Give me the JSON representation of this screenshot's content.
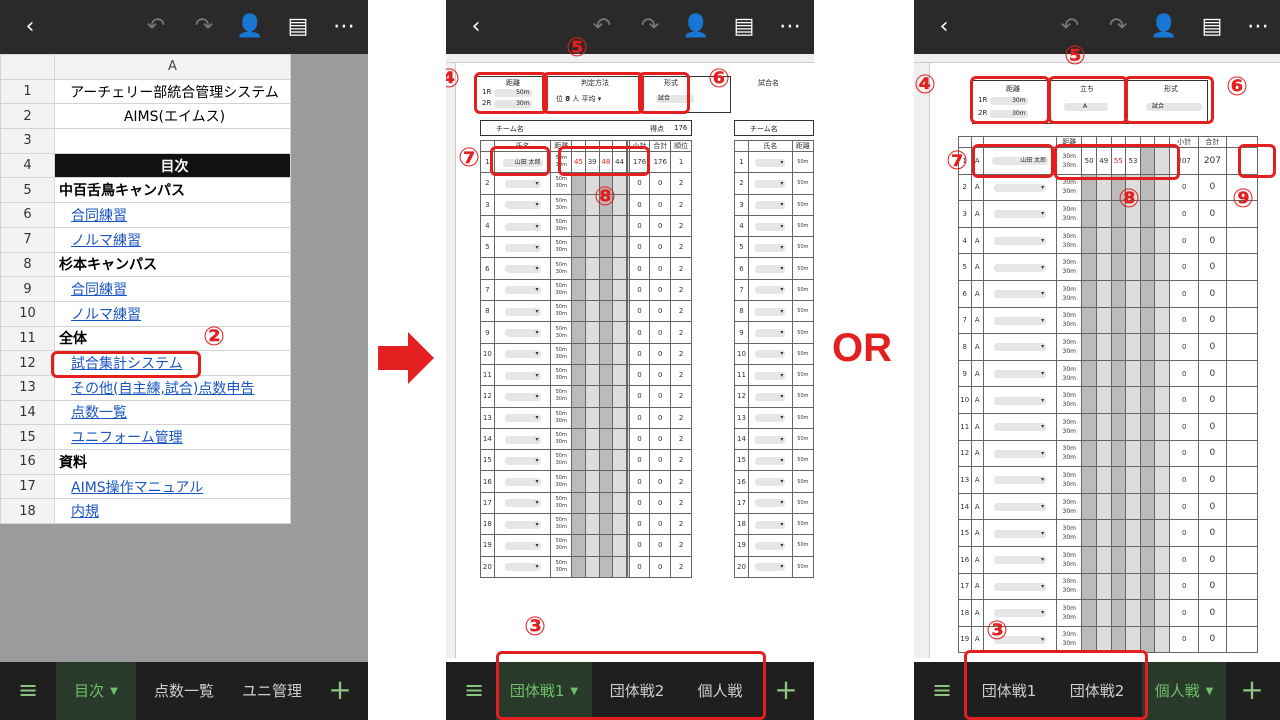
{
  "left_phone": {
    "column_header": "A",
    "rows": [
      {
        "n": "1",
        "text": "アーチェリー部統合管理システム",
        "style": "center"
      },
      {
        "n": "2",
        "text": "AIMS(エイムス)",
        "style": "center"
      },
      {
        "n": "3",
        "text": "",
        "style": ""
      },
      {
        "n": "4",
        "text": "目次",
        "style": "dark"
      },
      {
        "n": "5",
        "text": "中百舌鳥キャンパス",
        "style": "bold"
      },
      {
        "n": "6",
        "text": "合同練習",
        "style": "link"
      },
      {
        "n": "7",
        "text": "ノルマ練習",
        "style": "link"
      },
      {
        "n": "8",
        "text": "杉本キャンパス",
        "style": "bold"
      },
      {
        "n": "9",
        "text": "合同練習",
        "style": "link"
      },
      {
        "n": "10",
        "text": "ノルマ練習",
        "style": "link"
      },
      {
        "n": "11",
        "text": "全体",
        "style": "bold"
      },
      {
        "n": "12",
        "text": "試合集計システム",
        "style": "link"
      },
      {
        "n": "13",
        "text": "その他(自主練,試合)点数申告",
        "style": "link"
      },
      {
        "n": "14",
        "text": "点数一覧",
        "style": "link"
      },
      {
        "n": "15",
        "text": "ユニフォーム管理",
        "style": "link"
      },
      {
        "n": "16",
        "text": "資料",
        "style": "bold"
      },
      {
        "n": "17",
        "text": "AIMS操作マニュアル",
        "style": "link"
      },
      {
        "n": "18",
        "text": "内規",
        "style": "link"
      }
    ],
    "tabs": [
      "目次",
      "点数一覧",
      "ユニ管理"
    ],
    "active_tab": "目次"
  },
  "middle_phone": {
    "header_labels": {
      "distance": "距離",
      "judge": "判定方法",
      "format": "形式",
      "match_name": "試合名"
    },
    "dist_rows": [
      {
        "r": "1R",
        "v": "50m"
      },
      {
        "r": "2R",
        "v": "30m"
      }
    ],
    "judge_text": "位",
    "judge_value": "8",
    "judge_unit": "人",
    "judge_mode": "平均",
    "format_value": "試合",
    "team_label": "チーム名",
    "score_label": "得点",
    "score_value": "176",
    "col_headers": {
      "subtotal": "小計",
      "total": "合計",
      "rank": "順位",
      "name": "氏名",
      "distance": "距離"
    },
    "first_row": {
      "name": "山田 太郎",
      "scores": [
        "45",
        "39",
        "48",
        "44"
      ],
      "subtotal": "176",
      "total": "176",
      "rank": "1"
    },
    "tabs": [
      "団体戦1",
      "団体戦2",
      "個人戦"
    ],
    "active_tab": "団体戦1"
  },
  "right_phone": {
    "header_labels": {
      "distance": "距離",
      "stand": "立ち",
      "format": "形式"
    },
    "dist_rows": [
      {
        "r": "1R",
        "v": "30m"
      },
      {
        "r": "2R",
        "v": "30m"
      }
    ],
    "stand_value": "A",
    "format_value": "試合",
    "col_headers": {
      "subtotal": "小計",
      "total": "合計",
      "distance": "距離"
    },
    "first_row": {
      "name": "山田 太郎",
      "distance": "30m",
      "scores": [
        "50",
        "49",
        "55",
        "53"
      ],
      "subtotal": "207",
      "total": "207"
    },
    "tabs": [
      "団体戦1",
      "団体戦2",
      "個人戦"
    ]
  },
  "annotations": {
    "m2": "②",
    "m3": "③",
    "m4": "④",
    "m5": "⑤",
    "m6": "⑥",
    "m7": "⑦",
    "m8": "⑧",
    "m9": "⑨",
    "or_text": "OR"
  },
  "colors": {
    "accent_red": "#e41f1f",
    "active_tab_green": "#6fbf6a",
    "topbar": "#2a2a2a"
  }
}
